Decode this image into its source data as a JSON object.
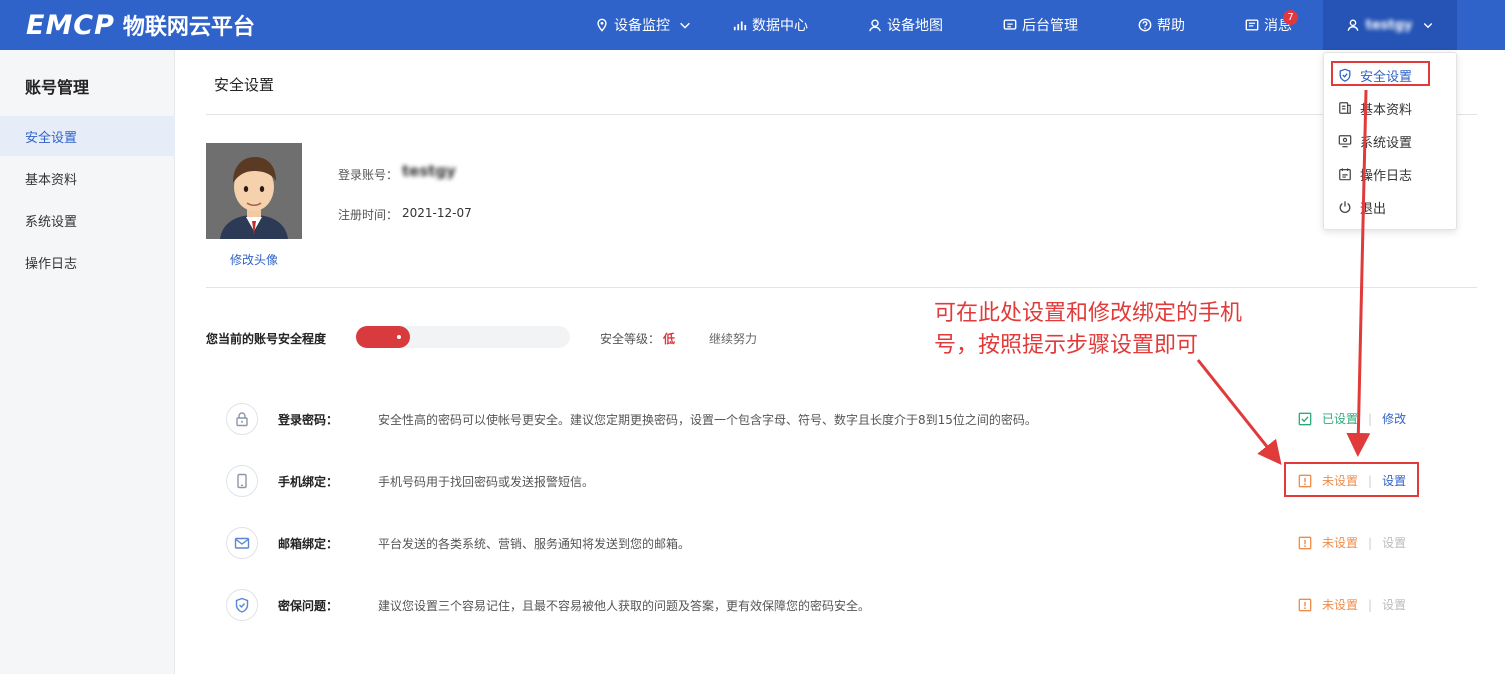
{
  "header": {
    "logo_emcp": "EMCP",
    "logo_text": "物联网云平台",
    "nav": [
      {
        "label": "设备监控"
      },
      {
        "label": "数据中心"
      },
      {
        "label": "设备地图"
      },
      {
        "label": "后台管理"
      },
      {
        "label": "帮助"
      },
      {
        "label": "消息"
      }
    ],
    "message_count": "7",
    "username": "testgy"
  },
  "dropdown": {
    "items": [
      {
        "label": "安全设置",
        "icon": "shield-icon"
      },
      {
        "label": "基本资料",
        "icon": "profile-icon"
      },
      {
        "label": "系统设置",
        "icon": "monitor-icon"
      },
      {
        "label": "操作日志",
        "icon": "log-icon"
      },
      {
        "label": "退出",
        "icon": "power-icon"
      }
    ]
  },
  "sidebar": {
    "title": "账号管理",
    "items": [
      {
        "label": "安全设置"
      },
      {
        "label": "基本资料"
      },
      {
        "label": "系统设置"
      },
      {
        "label": "操作日志"
      }
    ]
  },
  "main": {
    "title": "安全设置",
    "change_avatar": "修改头像",
    "account_label": "登录账号：",
    "account_value": "testgy",
    "reg_label": "注册时间：",
    "reg_value": "2021-12-07",
    "security_label": "您当前的账号安全程度",
    "security_progress": 0.25,
    "level_label": "安全等级：",
    "level_value": "低",
    "level_tip": "继续努力",
    "rows": [
      {
        "label": "登录密码：",
        "desc": "安全性高的密码可以使帐号更安全。建议您定期更换密码，设置一个包含字母、符号、数字且长度介于8到15位之间的密码。",
        "status": "已设置",
        "action": "修改",
        "icon": "lock-icon"
      },
      {
        "label": "手机绑定：",
        "desc": "手机号码用于找回密码或发送报警短信。",
        "status": "未设置",
        "action": "设置",
        "icon": "phone-icon"
      },
      {
        "label": "邮箱绑定：",
        "desc": "平台发送的各类系统、营销、服务通知将发送到您的邮箱。",
        "status": "未设置",
        "action": "设置",
        "icon": "mail-icon"
      },
      {
        "label": "密保问题：",
        "desc": "建议您设置三个容易记住，且最不容易被他人获取的问题及答案，更有效保障您的密码安全。",
        "status": "未设置",
        "action": "设置",
        "icon": "shield-check-icon"
      }
    ]
  },
  "annotation": {
    "line1": "可在此处设置和修改绑定的手机",
    "line2": "号，按照提示步骤设置即可"
  },
  "colors": {
    "primary": "#2f63c9",
    "danger": "#d93a3d",
    "ok": "#2daa7a",
    "warn": "#ef8c4a",
    "annotation": "#e03a3a"
  }
}
